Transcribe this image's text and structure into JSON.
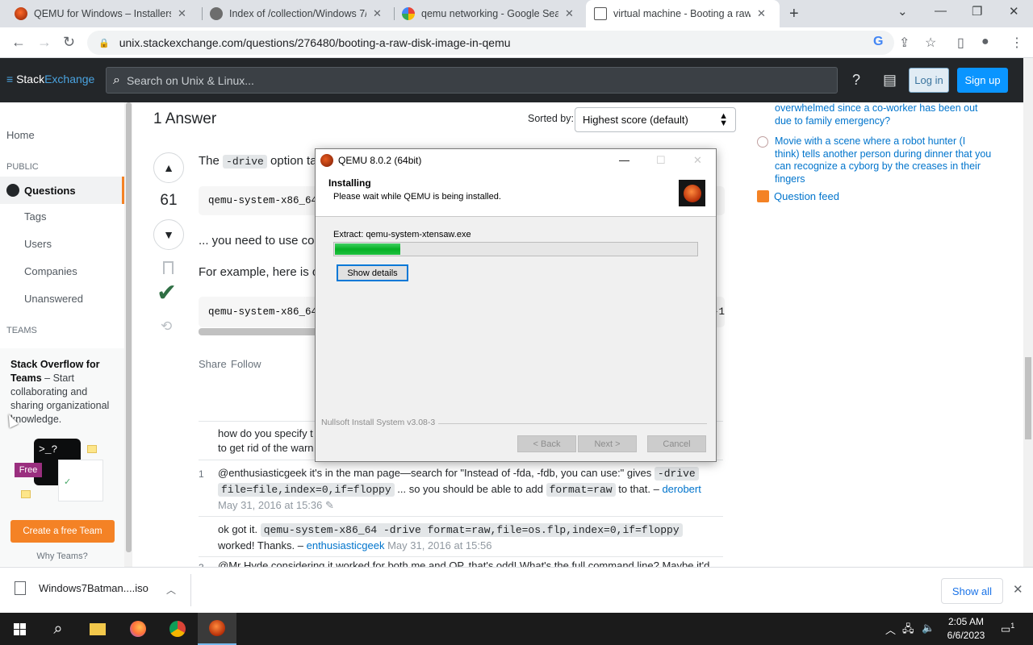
{
  "browser": {
    "tabs": [
      {
        "title": "QEMU for Windows – Installers (",
        "favicon": "qemu-favicon"
      },
      {
        "title": "Index of /collection/Windows 7/",
        "favicon": "archive-favicon"
      },
      {
        "title": "qemu networking - Google Searc",
        "favicon": "google-favicon"
      },
      {
        "title": "virtual machine - Booting a raw d",
        "favicon": "unix-se-favicon",
        "active": true
      }
    ],
    "url": "unix.stackexchange.com/questions/276480/booting-a-raw-disk-image-in-qemu"
  },
  "se_header": {
    "logo_prefix": "Stack",
    "logo_suffix": "Exchange",
    "search_placeholder": "Search on Unix & Linux...",
    "login_label": "Log in",
    "signup_label": "Sign up"
  },
  "left_nav": {
    "home": "Home",
    "public_heading": "PUBLIC",
    "questions": "Questions",
    "tags": "Tags",
    "users": "Users",
    "companies": "Companies",
    "unanswered": "Unanswered",
    "teams_heading": "TEAMS",
    "teams_title": "Stack Overflow for Teams",
    "teams_body": "– Start collaborating and sharing organizational knowledge.",
    "free_badge": "Free",
    "create_team": "Create a free Team",
    "why_teams": "Why Teams?"
  },
  "answer": {
    "count_label": "1 Answer",
    "sorted_by": "Sorted by:",
    "sort_value": "Highest score (default)",
    "votes": "61",
    "line1_pre": "The",
    "line1_code": "-drive",
    "line1_post": "option ta",
    "code1": "qemu-system-x86_64",
    "line2": "... you need to use co",
    "line3": "For example, here is o",
    "code2": "qemu-system-x86_64",
    "code2_tail": "-1",
    "share": "Share",
    "follow": "Follow"
  },
  "comments": [
    {
      "score": "",
      "text": "how do you specify t",
      "text2": "to get rid of the warn"
    },
    {
      "score": "1",
      "text_pre": "@enthusiasticgeek it's in the man page—search for \"Instead of -fda, -fdb, you can use:\" gives",
      "code1": "-drive",
      "code2": "file=file,index=0,if=floppy",
      "text_mid": "... so you should be able to add",
      "code3": "format=raw",
      "text_post": "to that. –",
      "user": "derobert",
      "date": "May 31, 2016 at 15:36"
    },
    {
      "score": "",
      "text_pre": "ok got it.",
      "code": "qemu-system-x86_64 -drive format=raw,file=os.flp,index=0,if=floppy",
      "text_post": "worked! Thanks. –",
      "user": "enthusiasticgeek",
      "date": "May 31, 2016 at 15:56"
    },
    {
      "score": "3",
      "text": "@Mr Hyde considering it worked for both me and OP, that's odd! What's the full command line? Maybe it'd"
    }
  ],
  "right_sidebar": {
    "hot_questions": [
      {
        "text": "overwhelmed since a co-worker has been out due to family emergency?"
      },
      {
        "text": "Movie with a scene where a robot hunter (I think) tells another person during dinner that you can recognize a cyborg by the creases in their fingers"
      }
    ],
    "question_feed": "Question feed"
  },
  "installer": {
    "window_title": "QEMU 8.0.2 (64bit)",
    "heading": "Installing",
    "subheading": "Please wait while QEMU is being installed.",
    "extract_label": "Extract: qemu-system-xtensaw.exe",
    "progress": 0.18,
    "show_details": "Show details",
    "nsis": "Nullsoft Install System v3.08-3",
    "back": "< Back",
    "next": "Next >",
    "cancel": "Cancel"
  },
  "download_bar": {
    "filename": "Windows7Batman....iso",
    "show_all": "Show all"
  },
  "taskbar": {
    "time": "2:05 AM",
    "date": "6/6/2023",
    "notification_count": "1"
  },
  "colors": {
    "se_header_bg": "#232629",
    "accent_orange": "#f48225",
    "link_blue": "#0074cc",
    "progress_green": "#06b025"
  }
}
